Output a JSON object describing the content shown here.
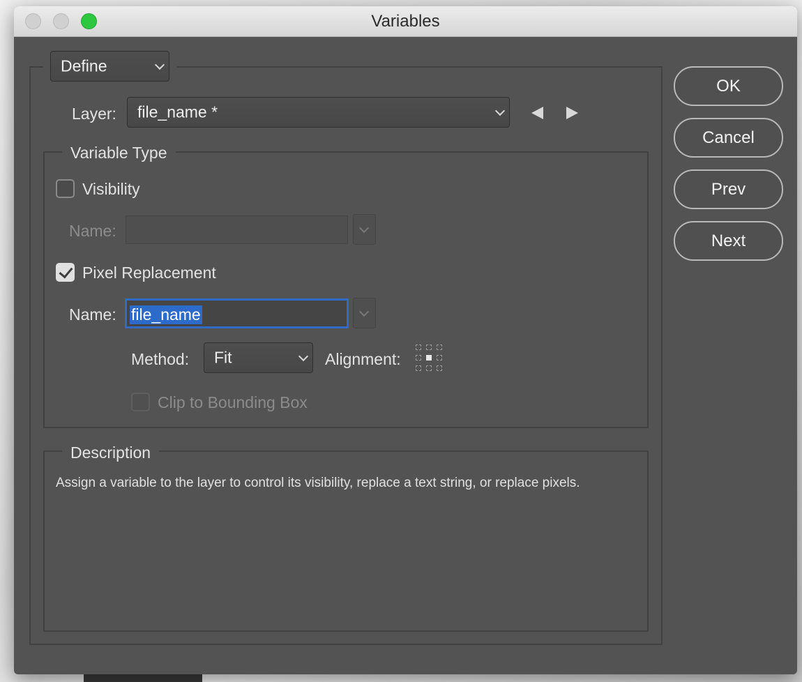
{
  "window": {
    "title": "Variables"
  },
  "mode_select": {
    "value": "Define"
  },
  "layer": {
    "label": "Layer:",
    "value": "file_name *"
  },
  "variable_type": {
    "legend": "Variable Type",
    "visibility": {
      "label": "Visibility",
      "checked": false,
      "name_label": "Name:",
      "name_value": ""
    },
    "pixel_replacement": {
      "label": "Pixel Replacement",
      "checked": true,
      "name_label": "Name:",
      "name_value": "file_name",
      "method_label": "Method:",
      "method_value": "Fit",
      "alignment_label": "Alignment:",
      "alignment_value": "center",
      "clip_label": "Clip to Bounding Box",
      "clip_checked": false
    }
  },
  "description": {
    "legend": "Description",
    "text": "Assign a variable to the layer to control its visibility, replace a text string, or replace pixels."
  },
  "buttons": {
    "ok": "OK",
    "cancel": "Cancel",
    "prev": "Prev",
    "next": "Next"
  },
  "colors": {
    "panel": "#535353",
    "focus": "#2f6bc7",
    "zoom_light": "#2dc840"
  },
  "icons": {
    "prev_layer": "triangle-left-icon",
    "next_layer": "triangle-right-icon",
    "dropdown": "chevron-down-icon"
  }
}
